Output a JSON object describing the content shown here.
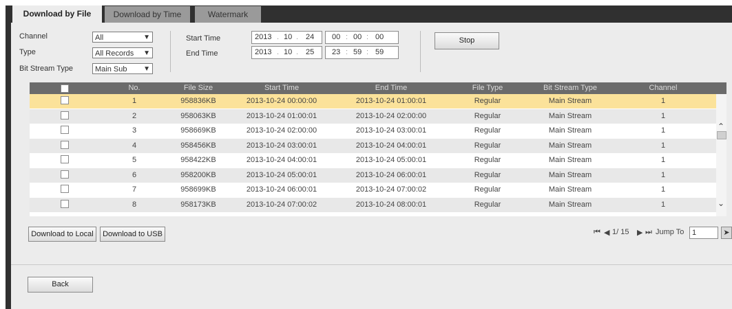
{
  "tabs": [
    {
      "label": "Download by File",
      "active": true
    },
    {
      "label": "Download by Time",
      "active": false
    },
    {
      "label": "Watermark",
      "active": false
    }
  ],
  "filters": {
    "channel_label": "Channel",
    "channel_value": "All",
    "type_label": "Type",
    "type_value": "All Records",
    "bitstream_label": "Bit Stream Type",
    "bitstream_value": "Main Sub",
    "start_label": "Start Time",
    "start_date": {
      "y": "2013",
      "m": "10",
      "d": "24"
    },
    "start_time": {
      "h": "00",
      "m": "00",
      "s": "00"
    },
    "end_label": "End Time",
    "end_date": {
      "y": "2013",
      "m": "10",
      "d": "25"
    },
    "end_time": {
      "h": "23",
      "m": "59",
      "s": "59"
    },
    "stop_label": "Stop"
  },
  "table": {
    "headers": [
      "No.",
      "File Size",
      "Start Time",
      "End Time",
      "File Type",
      "Bit Stream Type",
      "Channel"
    ],
    "rows": [
      {
        "no": "1",
        "size": "958836KB",
        "start": "2013-10-24 00:00:00",
        "end": "2013-10-24 01:00:01",
        "type": "Regular",
        "stream": "Main Stream",
        "channel": "1"
      },
      {
        "no": "2",
        "size": "958063KB",
        "start": "2013-10-24 01:00:01",
        "end": "2013-10-24 02:00:00",
        "type": "Regular",
        "stream": "Main Stream",
        "channel": "1"
      },
      {
        "no": "3",
        "size": "958669KB",
        "start": "2013-10-24 02:00:00",
        "end": "2013-10-24 03:00:01",
        "type": "Regular",
        "stream": "Main Stream",
        "channel": "1"
      },
      {
        "no": "4",
        "size": "958456KB",
        "start": "2013-10-24 03:00:01",
        "end": "2013-10-24 04:00:01",
        "type": "Regular",
        "stream": "Main Stream",
        "channel": "1"
      },
      {
        "no": "5",
        "size": "958422KB",
        "start": "2013-10-24 04:00:01",
        "end": "2013-10-24 05:00:01",
        "type": "Regular",
        "stream": "Main Stream",
        "channel": "1"
      },
      {
        "no": "6",
        "size": "958200KB",
        "start": "2013-10-24 05:00:01",
        "end": "2013-10-24 06:00:01",
        "type": "Regular",
        "stream": "Main Stream",
        "channel": "1"
      },
      {
        "no": "7",
        "size": "958699KB",
        "start": "2013-10-24 06:00:01",
        "end": "2013-10-24 07:00:02",
        "type": "Regular",
        "stream": "Main Stream",
        "channel": "1"
      },
      {
        "no": "8",
        "size": "958173KB",
        "start": "2013-10-24 07:00:02",
        "end": "2013-10-24 08:00:01",
        "type": "Regular",
        "stream": "Main Stream",
        "channel": "1"
      }
    ],
    "selected_row_color": "#fbe29a",
    "even_row_color": "#e8e8e8"
  },
  "actions": {
    "download_local": "Download to Local",
    "download_usb": "Download to USB",
    "back": "Back"
  },
  "pager": {
    "page": "1/ 15",
    "jump_label": "Jump To",
    "jump_value": "1"
  },
  "icons": [
    "dropdown-arrow-icon",
    "scroll-up-icon",
    "scroll-down-icon",
    "first-page-icon",
    "prev-page-icon",
    "next-page-icon",
    "last-page-icon",
    "go-icon"
  ]
}
